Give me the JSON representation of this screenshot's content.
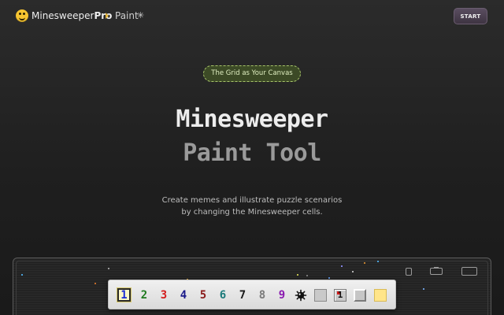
{
  "header": {
    "brand_name": "Minesweeper",
    "brand_suffix": "Pro",
    "breadcrumb": "Paint",
    "breadcrumb_icon": "✳",
    "start_label": "START"
  },
  "hero": {
    "badge": "The Grid as Your Canvas",
    "title_line1": "Minesweeper",
    "title_line2": "Paint Tool",
    "subtitle_line1": "Create memes and illustrate puzzle scenarios",
    "subtitle_line2": "by changing the Minesweeper cells."
  },
  "palette": {
    "numbers": [
      {
        "label": "1",
        "color": "#1b2bd6"
      },
      {
        "label": "2",
        "color": "#1e7a1e"
      },
      {
        "label": "3",
        "color": "#d41c1c"
      },
      {
        "label": "4",
        "color": "#1a1a8a"
      },
      {
        "label": "5",
        "color": "#8a1a1a"
      },
      {
        "label": "6",
        "color": "#1a7a7a"
      },
      {
        "label": "7",
        "color": "#1a1a1a"
      },
      {
        "label": "8",
        "color": "#7a7a7a"
      },
      {
        "label": "9",
        "color": "#8a1ab0"
      }
    ],
    "selected": "1",
    "extra_tools": [
      "mine",
      "plain-cell",
      "flag-cell",
      "raised-cell",
      "highlight-cell"
    ],
    "flag_cell_label": "1"
  },
  "colors": {
    "accent_start": "#4a3f50",
    "badge_border": "#a8c56a",
    "badge_bg": "#3c4a26",
    "logo": "#f7c531"
  }
}
